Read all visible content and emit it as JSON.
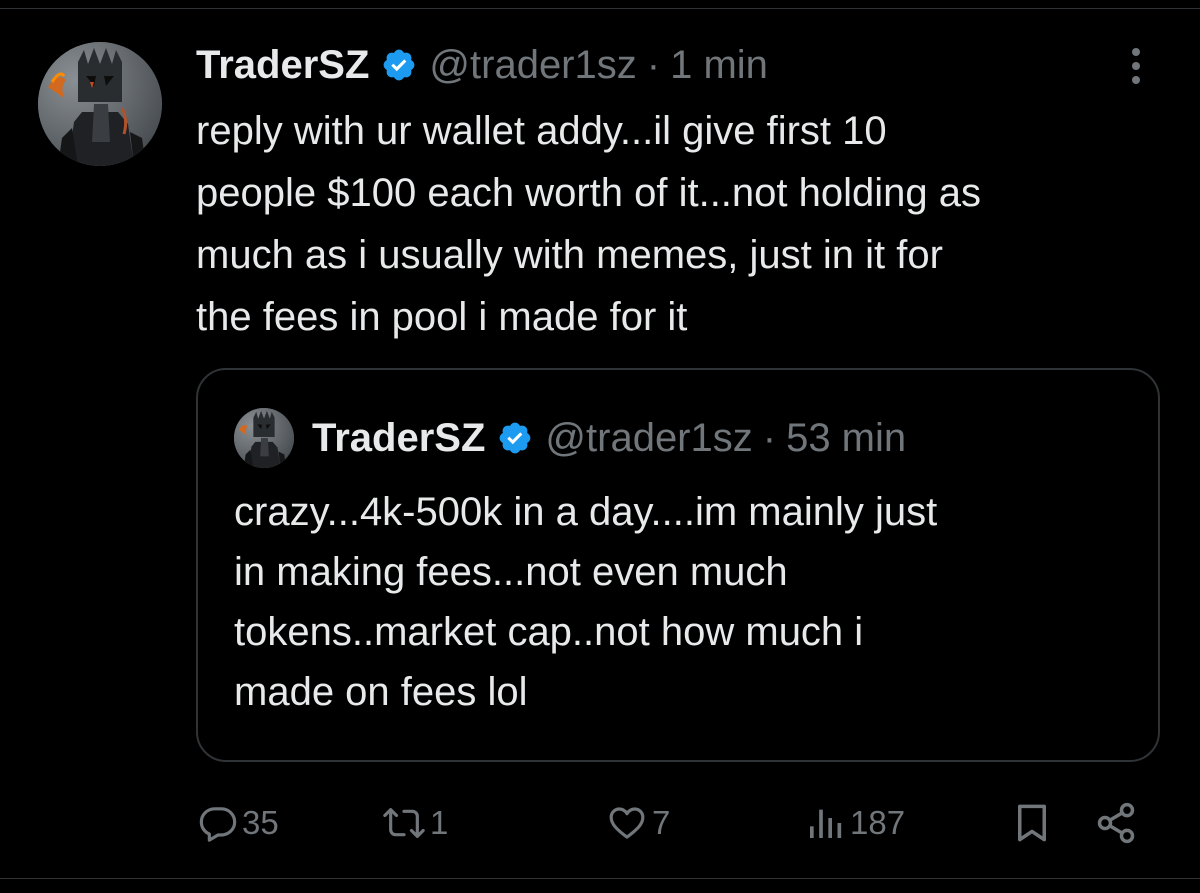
{
  "tweet": {
    "author_name": "TraderSZ",
    "handle": "@trader1sz",
    "separator": "·",
    "time": "1 min",
    "text": "reply with ur wallet addy...il give first 10\npeople $100 each worth of it...not holding as\nmuch as i usually with memes, just in it for\nthe fees in pool i made for it"
  },
  "quoted_tweet": {
    "author_name": "TraderSZ",
    "handle": "@trader1sz",
    "separator": "·",
    "time": "53 min",
    "text": "crazy...4k-500k in a day....im mainly just\nin making fees...not even much\ntokens..market cap..not how much i\nmade on fees lol"
  },
  "actions": {
    "replies": "35",
    "reposts": "1",
    "likes": "7",
    "views": "187"
  },
  "icons": {
    "verified": "verified-badge-icon",
    "more": "more-vertical-icon",
    "reply": "reply-icon",
    "repost": "repost-icon",
    "like": "heart-icon",
    "views": "views-chart-icon",
    "bookmark": "bookmark-icon",
    "share": "share-icon"
  },
  "colors": {
    "background": "#000000",
    "text": "#e7e9ea",
    "muted": "#71767b",
    "border": "#2f3336",
    "verified": "#1d9bf0"
  }
}
